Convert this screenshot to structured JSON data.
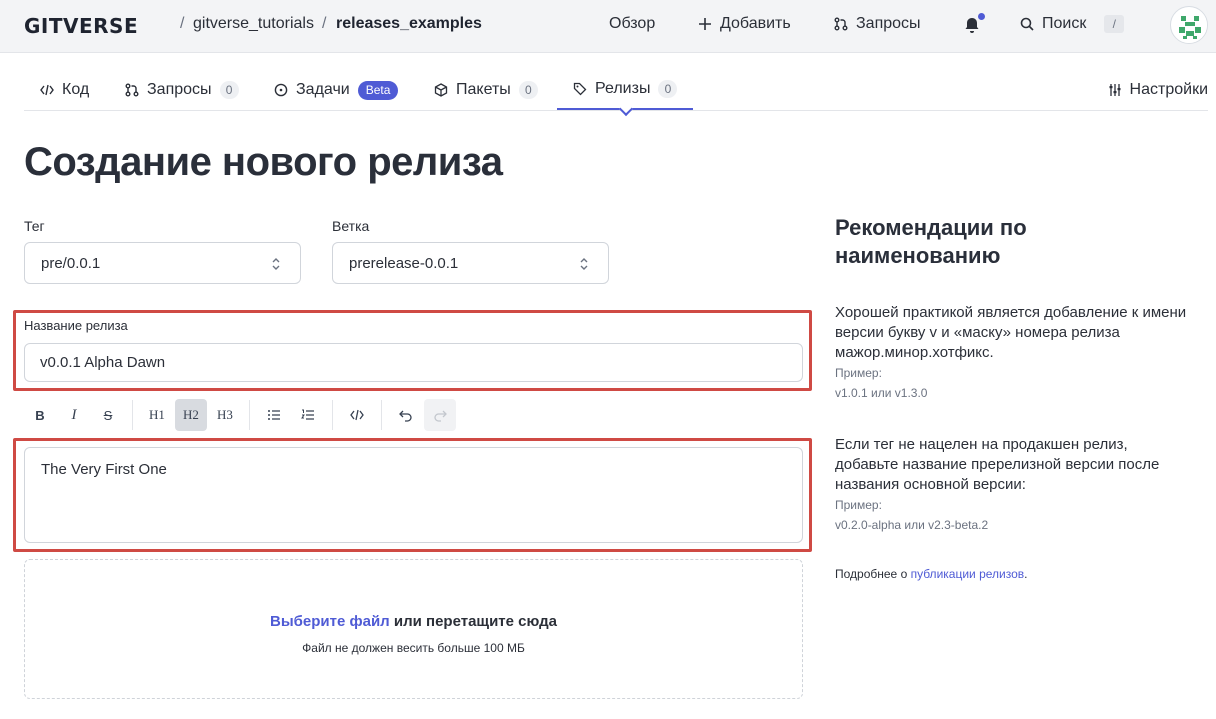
{
  "header": {
    "logo": "GITVERSE",
    "owner": "gitverse_tutorials",
    "repo": "releases_examples",
    "separator": "/",
    "nav": [
      {
        "label": "Обзор",
        "icon": "none"
      },
      {
        "label": "Добавить",
        "icon": "plus-icon"
      },
      {
        "label": "Запросы",
        "icon": "pull-request-icon"
      }
    ],
    "search_label": "Поиск",
    "search_shortcut": "/"
  },
  "tabs": [
    {
      "label": "Код",
      "icon": "code-icon"
    },
    {
      "label": "Запросы",
      "icon": "pull-request-icon",
      "count": "0"
    },
    {
      "label": "Задачи",
      "icon": "issue-icon",
      "badge": "Beta"
    },
    {
      "label": "Пакеты",
      "icon": "package-icon",
      "count": "0"
    },
    {
      "label": "Релизы",
      "icon": "tag-icon",
      "count": "0",
      "active": true
    }
  ],
  "settings_label": "Настройки",
  "page_title": "Создание нового релиза",
  "form": {
    "tag_label": "Тег",
    "tag_value": "pre/0.0.1",
    "branch_label": "Ветка",
    "branch_value": "prerelease-0.0.1",
    "release_name_label": "Название релиза",
    "release_name_value": "v0.0.1 Alpha Dawn",
    "toolbar": [
      "B",
      "I",
      "S",
      "H1",
      "H2",
      "H3",
      "bullet-list",
      "ordered-list",
      "code",
      "undo",
      "redo"
    ],
    "description_value": "The Very First One",
    "dropzone_link": "Выберите файл",
    "dropzone_text": "или перетащите сюда",
    "dropzone_hint": "Файл не должен весить больше 100 МБ"
  },
  "recommendations": {
    "title": "Рекомендации по наименованию",
    "p1": "Хорошей практикой является добавление к имени версии букву v и «маску» номера релиза мажор.минор.хотфикс.",
    "example_label_1": "Пример:",
    "example_1": "v1.0.1 или v1.3.0",
    "p2": "Если тег не нацелен на продакшен релиз, добавьте название пререлизной версии после названия основной версии:",
    "example_label_2": "Пример:",
    "example_2": "v0.2.0-alpha или v2.3-beta.2",
    "more_prefix": "Подробнее о",
    "more_link": "публикации релизов",
    "more_suffix": "."
  },
  "colors": {
    "accent": "#4f5bd5",
    "highlight": "#cf4a44"
  }
}
